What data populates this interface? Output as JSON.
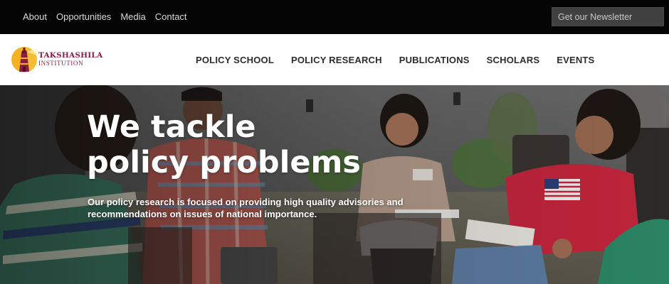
{
  "topbar": {
    "links": [
      "About",
      "Opportunities",
      "Media",
      "Contact"
    ],
    "newsletter_label": "Get our Newsletter"
  },
  "header": {
    "logo": {
      "name": "TAKSHASHILA",
      "sub": "INSTITUTION"
    },
    "nav": [
      "POLICY SCHOOL",
      "POLICY RESEARCH",
      "PUBLICATIONS",
      "SCHOLARS",
      "EVENTS"
    ]
  },
  "hero": {
    "title_line1": "We tackle",
    "title_line2": "policy problems",
    "subtitle": "Our policy research is focused on providing high quality advisories and recommendations on issues of national importance."
  },
  "colors": {
    "topbar_bg": "#050505",
    "brand_maroon": "#8b1e3f",
    "brand_yellow": "#f4b223"
  },
  "icons": {
    "logo": "lighthouse-logo-icon",
    "photo": "group-discussion-photo"
  }
}
